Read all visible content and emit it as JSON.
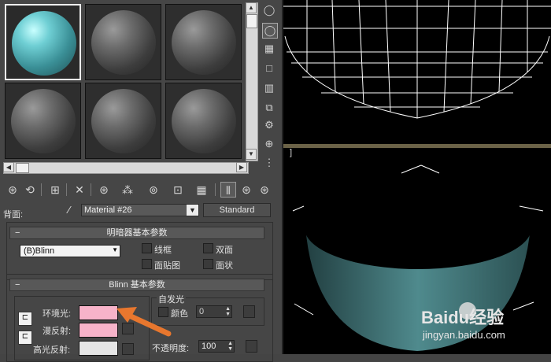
{
  "material": {
    "face_label": "背面:",
    "name": "Material #26",
    "type_button": "Standard"
  },
  "shader_rollout": {
    "toggle": "−",
    "title": "明暗器基本参数",
    "shader": "(B)Blinn",
    "options": [
      {
        "label": "线框",
        "checked": false
      },
      {
        "label": "双面",
        "checked": false
      },
      {
        "label": "面贴图",
        "checked": false
      },
      {
        "label": "面状",
        "checked": false
      }
    ]
  },
  "blinn_rollout": {
    "toggle": "−",
    "title": "Blinn 基本参数",
    "ambient_label": "环境光:",
    "diffuse_label": "漫反射:",
    "specular_label": "高光反射:",
    "ambient_color": "#f7b3c9",
    "diffuse_color": "#f7b3c9",
    "specular_color": "#e6e6e6",
    "self_illum_title": "自发光",
    "color_label": "颜色",
    "self_illum_value": "0",
    "opacity_label": "不透明度:",
    "opacity_value": "100"
  },
  "viewport": {
    "bracket": "]"
  },
  "watermark": {
    "brand": "Baidu经验",
    "url": "jingyan.baidu.com"
  },
  "colors": {
    "bowl_outer": "#3e6f72",
    "arrow": "#e8772e",
    "wire": "#ffffff"
  }
}
